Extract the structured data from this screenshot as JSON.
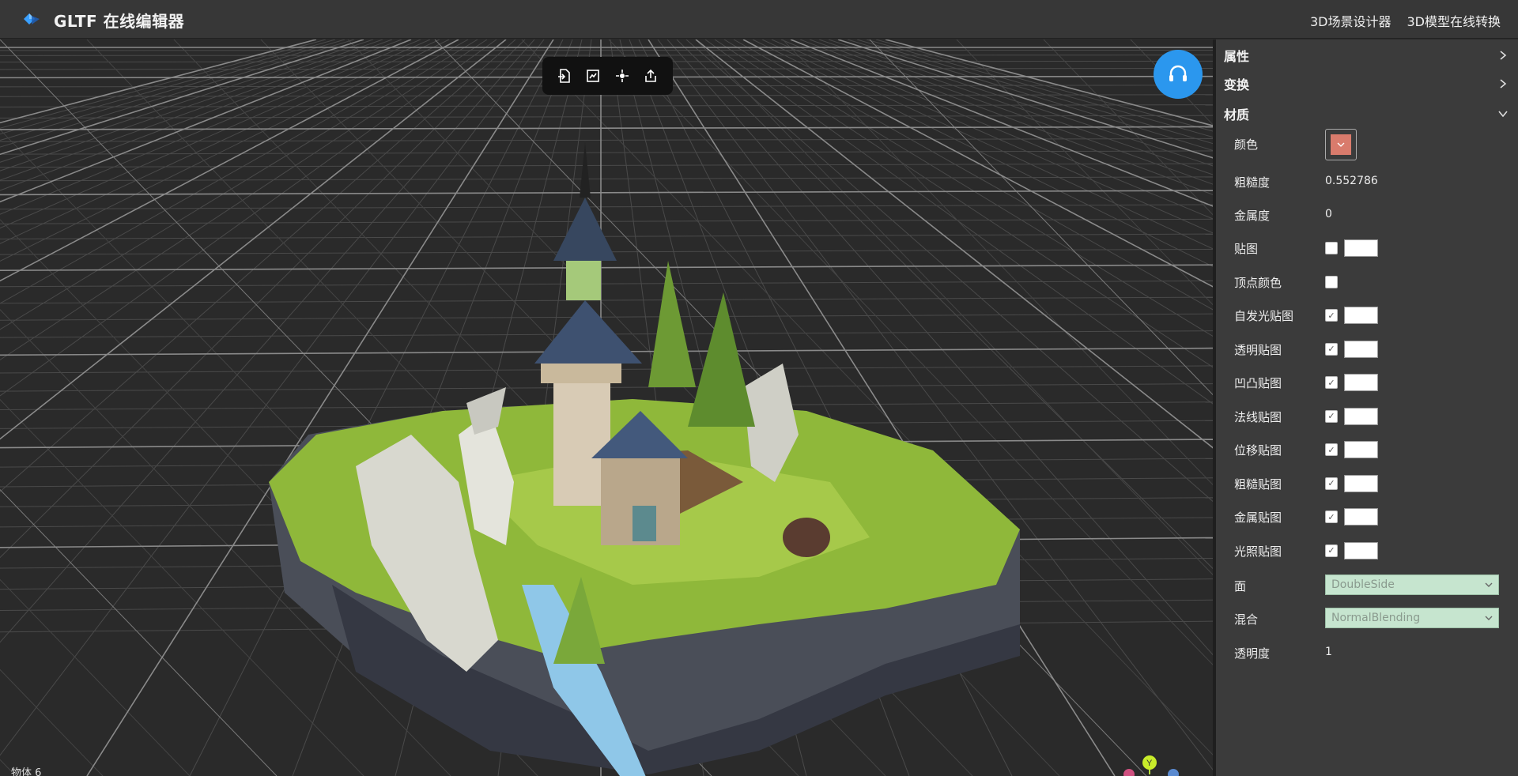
{
  "app": {
    "title": "GLTF 在线编辑器"
  },
  "nav": {
    "links": [
      "3D场景设计器",
      "3D模型在线转换"
    ]
  },
  "viewport": {
    "object_count": "物体 6",
    "axis_label": "Y",
    "toolbar": [
      "import-icon",
      "replace-icon",
      "center-icon",
      "export-icon"
    ]
  },
  "panel": {
    "sections": {
      "properties": "属性",
      "transform": "变换",
      "material": "材质"
    },
    "material": {
      "color_label": "颜色",
      "color_value": "#d97b6c",
      "roughness_label": "粗糙度",
      "roughness_value": "0.552786",
      "metalness_label": "金属度",
      "metalness_value": "0",
      "maps": [
        {
          "label": "贴图",
          "checked": false,
          "has_tex": true
        },
        {
          "label": "顶点颜色",
          "checked": false,
          "has_tex": false
        },
        {
          "label": "自发光贴图",
          "checked": true,
          "has_tex": true
        },
        {
          "label": "透明贴图",
          "checked": true,
          "has_tex": true
        },
        {
          "label": "凹凸贴图",
          "checked": true,
          "has_tex": true
        },
        {
          "label": "法线贴图",
          "checked": true,
          "has_tex": true
        },
        {
          "label": "位移贴图",
          "checked": true,
          "has_tex": true
        },
        {
          "label": "粗糙贴图",
          "checked": true,
          "has_tex": true
        },
        {
          "label": "金属贴图",
          "checked": true,
          "has_tex": true
        },
        {
          "label": "光照贴图",
          "checked": true,
          "has_tex": true
        }
      ],
      "side_label": "面",
      "side_value": "DoubleSide",
      "blend_label": "混合",
      "blend_value": "NormalBlending",
      "opacity_label": "透明度",
      "opacity_value": "1"
    }
  },
  "colors": {
    "accent": "#2b97ee",
    "swatch": "#d97b6c",
    "select_bg": "#c6e5cf"
  }
}
